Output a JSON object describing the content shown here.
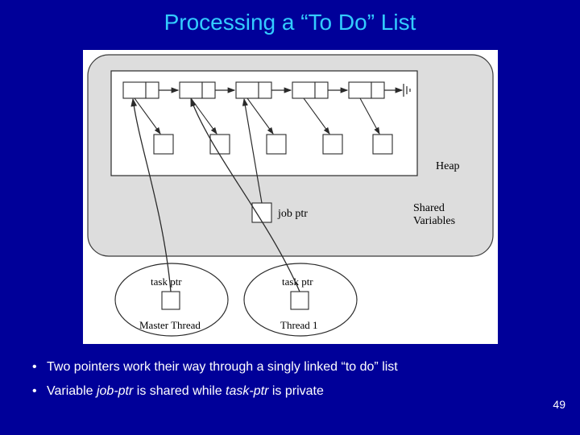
{
  "title": "Processing a “To Do” List",
  "diagram": {
    "labels": {
      "heap": "Heap",
      "shared": "Shared\nVariables",
      "job_ptr": "job  ptr",
      "master": "Master Thread",
      "thread1": "Thread 1",
      "task_ptr_left": "task  ptr",
      "task_ptr_right": "task ptr"
    }
  },
  "bullets": {
    "b1_pre": "Two pointers work their way through a singly linked “to do” list",
    "b2_pre": "Variable ",
    "b2_i1": "job-ptr",
    "b2_mid": " is shared while ",
    "b2_i2": "task-ptr",
    "b2_post": " is private"
  },
  "page_number": "49"
}
